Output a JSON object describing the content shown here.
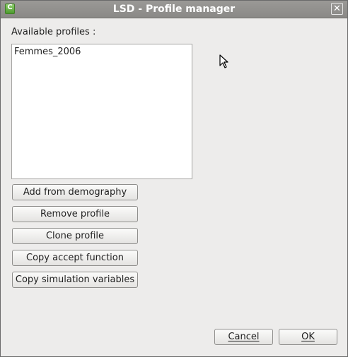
{
  "window": {
    "title": "LSD - Profile manager",
    "app_icon_glyph": "Ⓛ",
    "close_glyph": "✕"
  },
  "profiles": {
    "label": "Available profiles :",
    "items": [
      "Femmes_2006"
    ]
  },
  "actions": {
    "add_from_demography": "Add from demography",
    "remove_profile": "Remove profile",
    "clone_profile": "Clone profile",
    "copy_accept_function": "Copy accept function",
    "copy_simulation_variables": "Copy simulation variables"
  },
  "footer": {
    "cancel_label": "Cancel",
    "ok_label": "OK"
  },
  "icons": {
    "app": "app-icon",
    "close": "close-icon",
    "cursor": "mouse-pointer-icon"
  }
}
